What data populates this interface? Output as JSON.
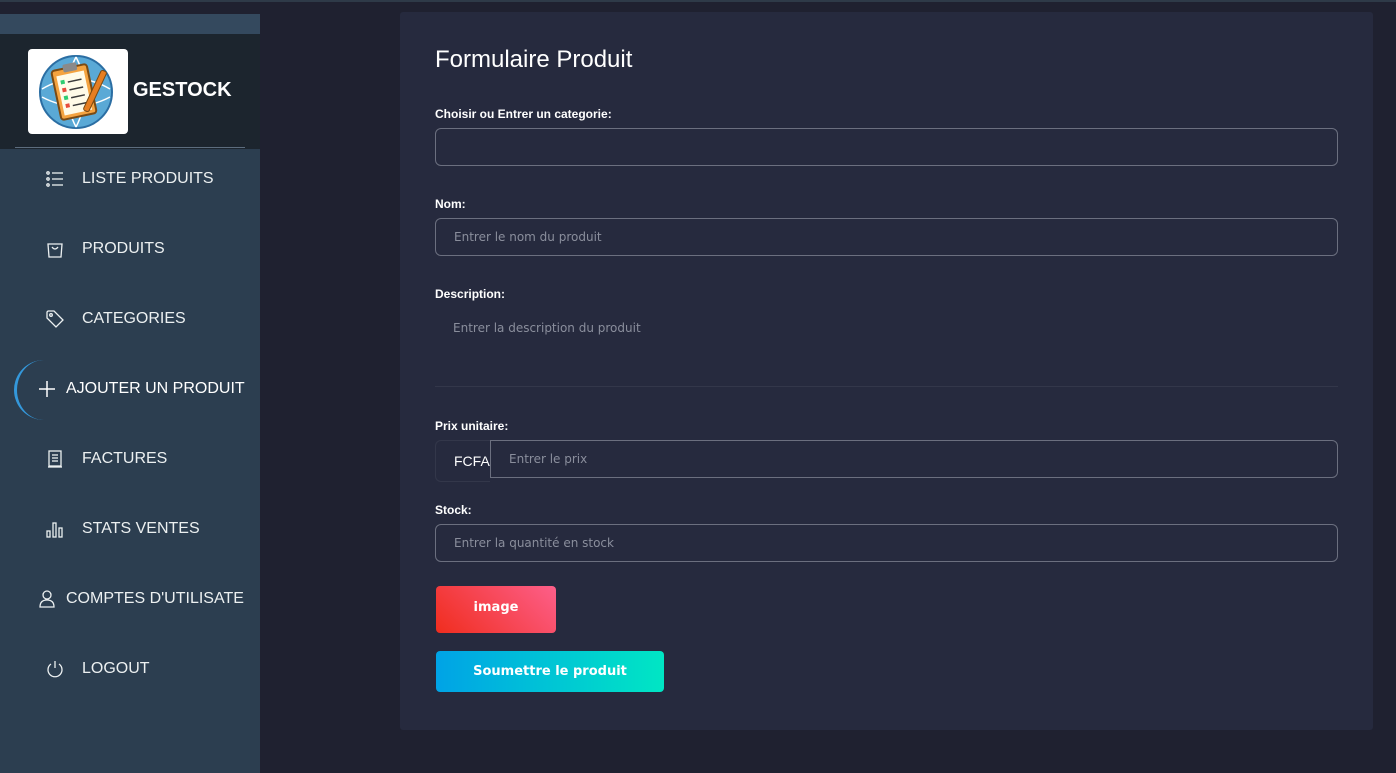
{
  "sidebar": {
    "brand_name": "GESTOCK",
    "items": [
      {
        "label": "LISTE PRODUITS",
        "icon": "list-icon"
      },
      {
        "label": "PRODUITS",
        "icon": "shopping-bag-icon"
      },
      {
        "label": "CATEGORIES",
        "icon": "tag-icon"
      },
      {
        "label": "AJOUTER UN PRODUIT",
        "icon": "plus-icon"
      },
      {
        "label": "FACTURES",
        "icon": "receipt-icon"
      },
      {
        "label": "STATS VENTES",
        "icon": "bar-chart-icon"
      },
      {
        "label": "COMPTES D'UTILISATE",
        "icon": "user-icon"
      },
      {
        "label": "LOGOUT",
        "icon": "power-icon"
      }
    ],
    "active_index": 3
  },
  "form": {
    "title": "Formulaire Produit",
    "category_label": "Choisir ou Entrer un categorie:",
    "category_value": "",
    "name_label": "Nom:",
    "name_placeholder": "Entrer le nom du produit",
    "description_label": "Description:",
    "description_placeholder": "Entrer la description du produit",
    "price_label": "Prix unitaire:",
    "currency": "FCFA",
    "price_placeholder": "Entrer le prix",
    "stock_label": "Stock:",
    "stock_placeholder": "Entrer la quantité en stock",
    "image_button": "image",
    "submit_button": "Soumettre le produit"
  },
  "colors": {
    "sidebar_bg": "#2c3e50",
    "panel_bg": "#262a3e",
    "image_button_gradient": [
      "#f02d1e",
      "#fd5f8a"
    ],
    "submit_button_gradient": [
      "#00a3e6",
      "#00e6c4"
    ],
    "active_accent": "#3498db"
  }
}
